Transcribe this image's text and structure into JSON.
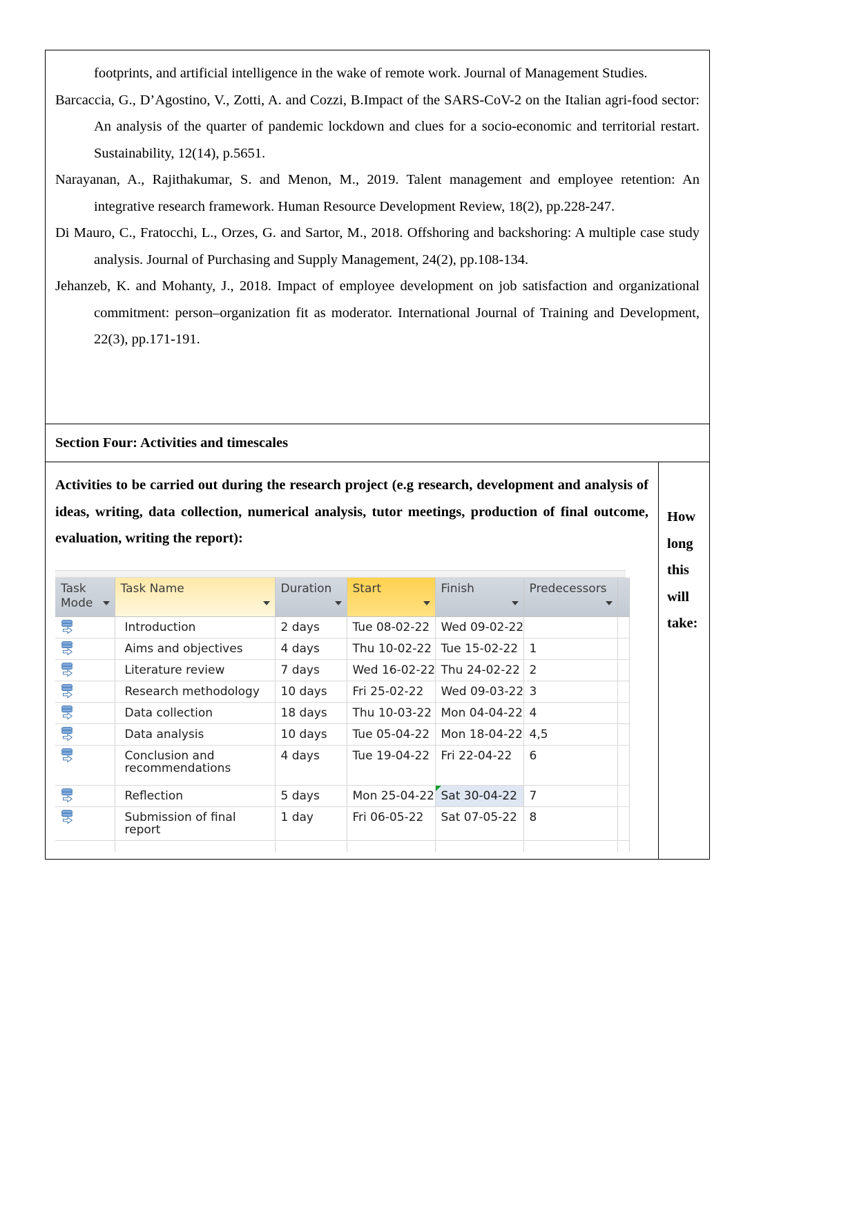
{
  "references": [
    {
      "lines": [
        "footprints, and artificial intelligence in the wake of remote work. Journal of Management Studies."
      ],
      "continuation_only": true
    },
    {
      "text": "Barcaccia, G., D’Agostino, V., Zotti, A. and Cozzi, B.Impact of the SARS-CoV-2 on the Italian agri-food sector: An analysis of the quarter of pandemic lockdown and clues for a socio-economic and territorial restart. Sustainability, 12(14), p.5651."
    },
    {
      "text": "Narayanan, A., Rajithakumar, S. and Menon, M., 2019. Talent management and employee retention: An integrative research framework. Human Resource Development Review, 18(2), pp.228-247."
    },
    {
      "text": "Di Mauro, C., Fratocchi, L., Orzes, G. and Sartor, M., 2018. Offshoring and backshoring: A multiple case study analysis. Journal of Purchasing and Supply Management, 24(2), pp.108-134."
    },
    {
      "text": "Jehanzeb, K. and Mohanty, J., 2018. Impact of employee development on job satisfaction and organizational commitment: person–organization fit as moderator. International Journal of Training and Development, 22(3), pp.171-191."
    }
  ],
  "reference_first_line": "footprints, and artificial intelligence in the wake of remote work. Journal of Management Studies.",
  "section": {
    "heading": "Section Four: Activities and timescales",
    "instruction": "Activities to be carried out during the research project (e.g research, development and analysis of ideas, writing, data collection, numerical analysis, tutor meetings, production of final outcome, evaluation, writing the report):",
    "how_long_label": "How long this will take:"
  },
  "project_table": {
    "columns": [
      {
        "key": "task_mode",
        "label": "Task Mode",
        "style": "plain"
      },
      {
        "key": "task_name",
        "label": "Task Name",
        "style": "yellow"
      },
      {
        "key": "duration",
        "label": "Duration",
        "style": "plain"
      },
      {
        "key": "start",
        "label": "Start",
        "style": "gold"
      },
      {
        "key": "finish",
        "label": "Finish",
        "style": "plain"
      },
      {
        "key": "predecessors",
        "label": "Predecessors",
        "style": "plain"
      }
    ],
    "rows": [
      {
        "task_name": "Introduction",
        "duration": "2 days",
        "start": "Tue 08-02-22",
        "finish": "Wed 09-02-22",
        "predecessors": ""
      },
      {
        "task_name": "Aims and objectives",
        "duration": "4 days",
        "start": "Thu 10-02-22",
        "finish": "Tue 15-02-22",
        "predecessors": "1"
      },
      {
        "task_name": "Literature review",
        "duration": "7 days",
        "start": "Wed 16-02-22",
        "finish": "Thu 24-02-22",
        "predecessors": "2"
      },
      {
        "task_name": "Research methodology",
        "duration": "10 days",
        "start": "Fri 25-02-22",
        "finish": "Wed 09-03-22",
        "predecessors": "3"
      },
      {
        "task_name": "Data collection",
        "duration": "18 days",
        "start": "Thu 10-03-22",
        "finish": "Mon 04-04-22",
        "predecessors": "4"
      },
      {
        "task_name": "Data analysis",
        "duration": "10 days",
        "start": "Tue 05-04-22",
        "finish": "Mon 18-04-22",
        "predecessors": "4,5"
      },
      {
        "task_name": "Conclusion and recommendations",
        "duration": "4 days",
        "start": "Tue 19-04-22",
        "finish": "Fri 22-04-22",
        "predecessors": "6",
        "tall": true
      },
      {
        "task_name": "Reflection",
        "duration": "5 days",
        "start": "Mon 25-04-22",
        "finish": "Sat 30-04-22",
        "predecessors": "7",
        "finish_highlighted": true
      },
      {
        "task_name": "Submission of final report",
        "duration": "1 day",
        "start": "Fri 06-05-22",
        "finish": "Sat 07-05-22",
        "predecessors": "8"
      }
    ]
  },
  "colors": {
    "header_gold": "#ffd14f",
    "header_yellow": "#ffe9a8",
    "header_grey": "#ccd2da",
    "highlight_cell": "#dee7f2",
    "green_indicator": "#0f9d2f",
    "task_icon_blue": "#5b8ec9"
  }
}
